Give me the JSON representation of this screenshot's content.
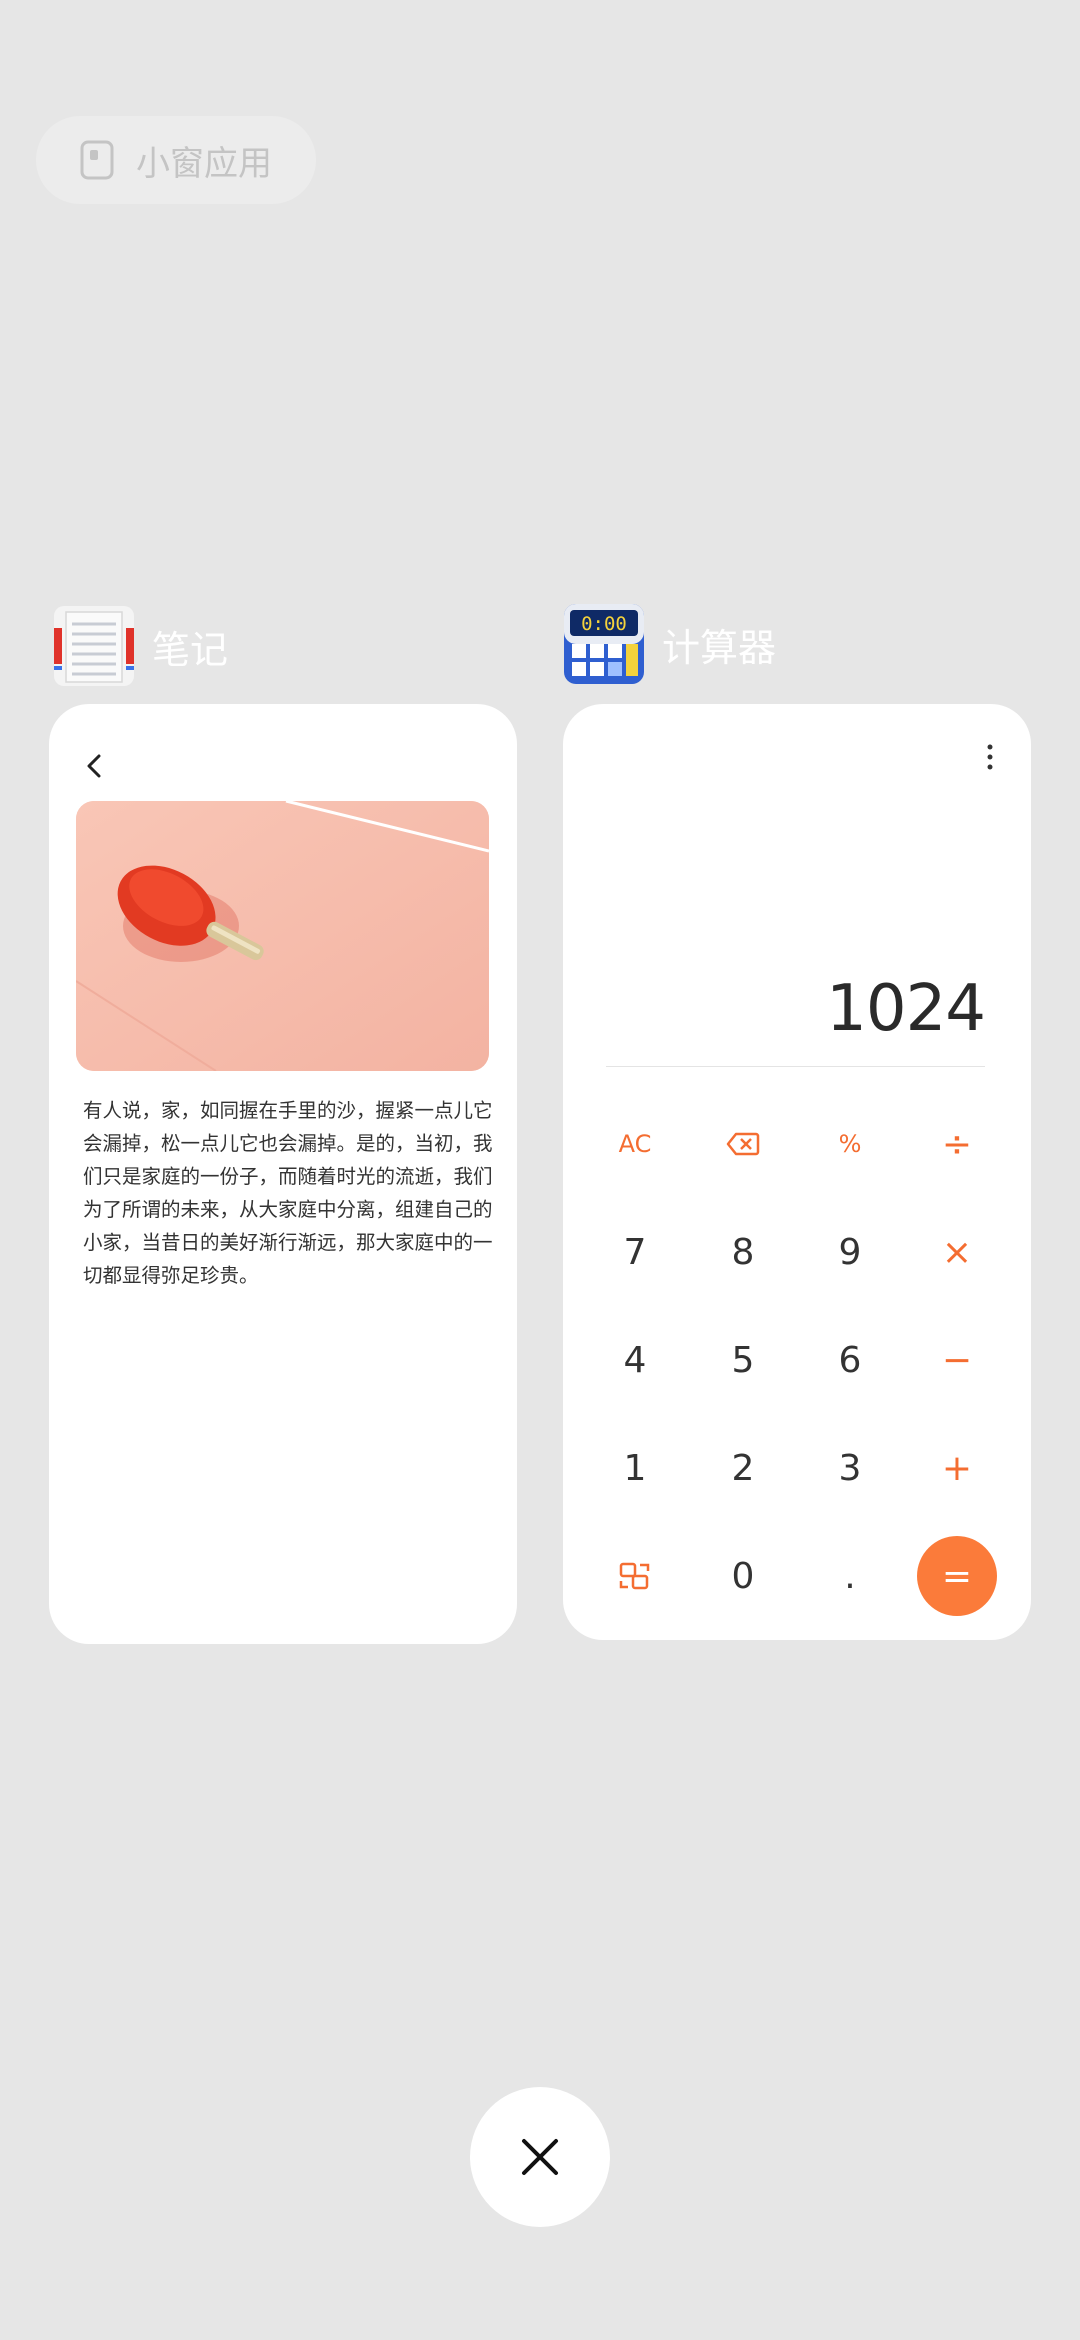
{
  "small_window_chip": {
    "label": "小窗应用",
    "icon": "small-window-icon"
  },
  "apps": {
    "notes": {
      "name": "笔记",
      "icon": "notes-app-icon"
    },
    "calculator": {
      "name": "计算器",
      "icon": "calculator-app-icon",
      "icon_screen_text": "0:00"
    }
  },
  "notes_card": {
    "back_icon": "chevron-left-icon",
    "image": "ping-pong-paddle-photo",
    "text": "有人说，家，如同握在手里的沙，握紧一点儿它会漏掉，松一点儿它也会漏掉。是的，当初，我们只是家庭的一份子，而随着时光的流逝，我们为了所谓的未来，从大家庭中分离，组建自己的小家，当昔日的美好渐行渐远，那大家庭中的一切都显得弥足珍贵。"
  },
  "calculator_card": {
    "display": "1024",
    "keys": {
      "ac": "AC",
      "percent": "%",
      "divide": "÷",
      "k7": "7",
      "k8": "8",
      "k9": "9",
      "multiply": "×",
      "k4": "4",
      "k5": "5",
      "k6": "6",
      "minus": "−",
      "k1": "1",
      "k2": "2",
      "k3": "3",
      "plus": "+",
      "k0": "0",
      "dot": ".",
      "equals": "="
    }
  },
  "colors": {
    "background": "#e6e6e6",
    "accent_orange": "#f46d31",
    "equals_button": "#fb7b3a"
  }
}
